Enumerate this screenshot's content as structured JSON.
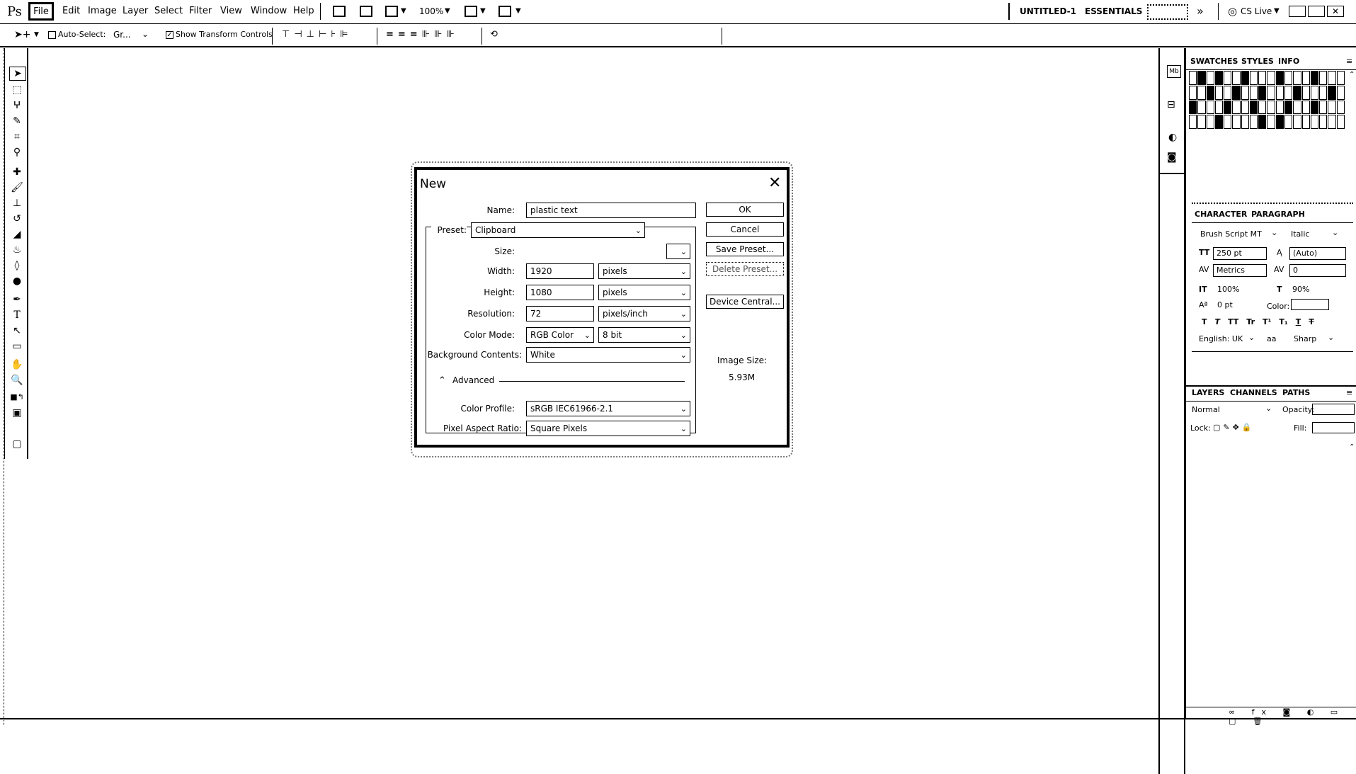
{
  "app": {
    "logo": "Ps"
  },
  "menubar": {
    "items": [
      "File",
      "Edit",
      "Image",
      "Layer",
      "Select",
      "Filter",
      "View",
      "Window",
      "Help"
    ],
    "zoom": "100%",
    "doc_title": "UNTITLED-1",
    "workspace": "ESSENTIALS",
    "cslive": "CS Live"
  },
  "options": {
    "auto_select": "Auto-Select:",
    "group": "Gr...",
    "show_transform": "Show Transform Controls"
  },
  "dialog": {
    "title": "New",
    "name_label": "Name:",
    "name_value": "plastic text",
    "preset_label": "Preset:",
    "preset_value": "Clipboard",
    "size_label": "Size:",
    "size_value": "",
    "width_label": "Width:",
    "width_value": "1920",
    "width_unit": "pixels",
    "height_label": "Height:",
    "height_value": "1080",
    "height_unit": "pixels",
    "resolution_label": "Resolution:",
    "resolution_value": "72",
    "resolution_unit": "pixels/inch",
    "colormode_label": "Color Mode:",
    "colormode_value": "RGB Color",
    "colormode_bits": "8 bit",
    "bg_label": "Background Contents:",
    "bg_value": "White",
    "advanced": "Advanced",
    "profile_label": "Color Profile:",
    "profile_value": "sRGB IEC61966-2.1",
    "pixel_aspect_label": "Pixel Aspect Ratio:",
    "pixel_aspect_value": "Square Pixels",
    "buttons": {
      "ok": "OK",
      "cancel": "Cancel",
      "save_preset": "Save Preset...",
      "delete_preset": "Delete Preset...",
      "device_central": "Device Central..."
    },
    "image_size_label": "Image Size:",
    "image_size_value": "5.93M"
  },
  "panels": {
    "tabs1": [
      "SWATCHES",
      "STYLES",
      "INFO"
    ],
    "tabs2": [
      "CHARACTER",
      "PARAGRAPH"
    ],
    "character": {
      "font": "Brush Script MT",
      "style": "Italic",
      "size": "250 pt",
      "leading": "(Auto)",
      "kerning": "Metrics",
      "tracking": "0",
      "vscale": "100%",
      "hscale": "90%",
      "baseline": "0 pt",
      "color_label": "Color:",
      "language": "English: UK",
      "aa_label": "aa",
      "antialias": "Sharp",
      "type_buttons": [
        "T",
        "T",
        "TT",
        "Tr",
        "T¹",
        "T₁",
        "T",
        "T"
      ]
    },
    "tabs3": [
      "LAYERS",
      "CHANNELS",
      "PATHS"
    ],
    "layers": {
      "blend": "Normal",
      "opacity_label": "Opacity:",
      "lock_label": "Lock:",
      "fill_label": "Fill:"
    }
  }
}
